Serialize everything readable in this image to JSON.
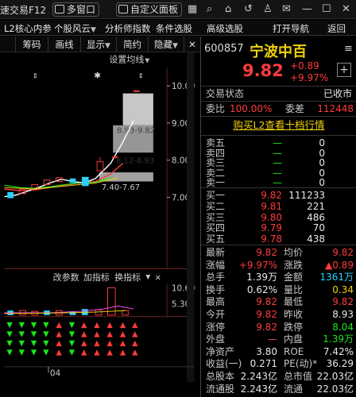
{
  "topbar": {
    "title_partial": "速交易F12",
    "multiwindow_label": "多窗口",
    "custom_panel_label": "自定义面板"
  },
  "nav": {
    "items": [
      "L2核心内参",
      "个股风云",
      "分析师指数",
      "条件选股",
      "高级选股",
      "打开导航",
      "返回"
    ]
  },
  "chart_tools": {
    "buttons": [
      "筹码",
      "画线",
      "显示",
      "简约",
      "隐藏"
    ],
    "settings_label": "设置均线",
    "price_ticks": [
      "10.00",
      "9.00",
      "8.00",
      "7.00"
    ],
    "range_label_upper": "8.93-9.82",
    "range_label_mid": "8.12-8.93",
    "range_label_low": "7.40-7.67",
    "indicator_tools": [
      "改参数",
      "加指标",
      "换指标"
    ],
    "volume_ticks": [
      "10.60",
      "5.30"
    ],
    "date_label": "04"
  },
  "stock": {
    "code": "600857",
    "name": "宁波中百",
    "price": "9.82",
    "change": "+0.89",
    "change_pct": "+9.97%"
  },
  "status": {
    "label": "交易状态",
    "value": "已收市",
    "ratio_label": "委比",
    "ratio_value": "100.00%",
    "diff_label": "委差",
    "diff_value": "112448",
    "l2_link": "购买L2查看十档行情"
  },
  "sell_orders": [
    {
      "label": "卖五",
      "price": "—",
      "vol": "0"
    },
    {
      "label": "卖四",
      "price": "—",
      "vol": "0"
    },
    {
      "label": "卖三",
      "price": "—",
      "vol": "0"
    },
    {
      "label": "卖二",
      "price": "—",
      "vol": "0"
    },
    {
      "label": "卖一",
      "price": "—",
      "vol": "0"
    }
  ],
  "buy_orders": [
    {
      "label": "买一",
      "price": "9.82",
      "vol": "111233"
    },
    {
      "label": "买二",
      "price": "9.81",
      "vol": "221"
    },
    {
      "label": "买三",
      "price": "9.80",
      "vol": "486"
    },
    {
      "label": "买四",
      "price": "9.79",
      "vol": "70"
    },
    {
      "label": "买五",
      "price": "9.78",
      "vol": "438"
    }
  ],
  "stats": [
    {
      "l1": "最新",
      "v1": "9.82",
      "c1": "red",
      "l2": "均价",
      "v2": "9.82",
      "c2": "red"
    },
    {
      "l1": "涨幅",
      "v1": "+9.97%",
      "c1": "red",
      "l2": "涨跌",
      "v2": "▲0.89",
      "c2": "red"
    },
    {
      "l1": "总手",
      "v1": "1.39万",
      "c1": "white",
      "l2": "金额",
      "v2": "1361万",
      "c2": "cyan"
    },
    {
      "l1": "换手",
      "v1": "0.62%",
      "c1": "white",
      "l2": "量比",
      "v2": "0.34",
      "c2": "yellow"
    },
    {
      "l1": "最高",
      "v1": "9.82",
      "c1": "red",
      "l2": "最低",
      "v2": "9.82",
      "c2": "red"
    },
    {
      "l1": "今开",
      "v1": "9.82",
      "c1": "red",
      "l2": "昨收",
      "v2": "8.93",
      "c2": "white"
    },
    {
      "l1": "涨停",
      "v1": "9.82",
      "c1": "red",
      "l2": "跌停",
      "v2": "8.04",
      "c2": "green"
    },
    {
      "l1": "外盘",
      "v1": "—",
      "c1": "red",
      "l2": "内盘",
      "v2": "1.39万",
      "c2": "green"
    },
    {
      "l1": "净资产",
      "v1": "3.80",
      "c1": "white",
      "l2": "ROE",
      "v2": "7.42%",
      "c2": "white"
    },
    {
      "l1": "收益(一)",
      "v1": "0.271",
      "c1": "white",
      "l2": "PE(动)*",
      "v2": "36.29",
      "c2": "white"
    },
    {
      "l1": "总股本",
      "v1": "2.243亿",
      "c1": "white",
      "l2": "总市值",
      "v2": "22.03亿",
      "c2": "white"
    },
    {
      "l1": "流通股",
      "v1": "2.243亿",
      "c1": "white",
      "l2": "流通",
      "v2": "22.03亿",
      "c2": "white"
    }
  ]
}
